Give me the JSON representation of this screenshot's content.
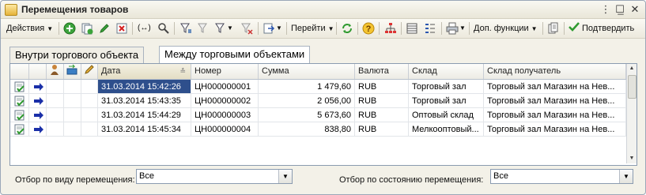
{
  "window": {
    "title": "Перемещения товаров",
    "minimize": "_",
    "maximize": "☐",
    "close": "✕"
  },
  "toolbar": {
    "actions_label": "Действия",
    "goto_label": "Перейти",
    "extra_label": "Доп. функции",
    "confirm_label": "Подтвердить",
    "brackets_label": "(↔)"
  },
  "tabs": [
    {
      "label": "Внутри торгового объекта"
    },
    {
      "label": "Между торговыми объектами"
    }
  ],
  "grid": {
    "headers": {
      "date": "Дата",
      "number": "Номер",
      "sum": "Сумма",
      "currency": "Валюта",
      "warehouse": "Склад",
      "receiver": "Склад получатель"
    },
    "rows": [
      {
        "date": "31.03.2014 15:42:26",
        "number": "ЦН000000001",
        "sum": "1 479,60",
        "currency": "RUB",
        "warehouse": "Торговый зал",
        "receiver": "Торговый зал Магазин на Нев..."
      },
      {
        "date": "31.03.2014 15:43:35",
        "number": "ЦН000000002",
        "sum": "2 056,00",
        "currency": "RUB",
        "warehouse": "Торговый зал",
        "receiver": "Торговый зал Магазин на Нев..."
      },
      {
        "date": "31.03.2014 15:44:29",
        "number": "ЦН000000003",
        "sum": "5 673,60",
        "currency": "RUB",
        "warehouse": "Оптовый склад",
        "receiver": "Торговый зал Магазин на Нев..."
      },
      {
        "date": "31.03.2014 15:45:34",
        "number": "ЦН000000004",
        "sum": "838,80",
        "currency": "RUB",
        "warehouse": "Мелкооптовый...",
        "receiver": "Торговый зал Магазин на Нев..."
      }
    ]
  },
  "filters": {
    "by_type_label": "Отбор по виду перемещения:",
    "by_type_value": "Все",
    "by_state_label": "Отбор по состоянию перемещения:",
    "by_state_value": "Все"
  },
  "colors": {
    "selection": "#2e4f8c",
    "arrow": "#1a2fa8"
  }
}
